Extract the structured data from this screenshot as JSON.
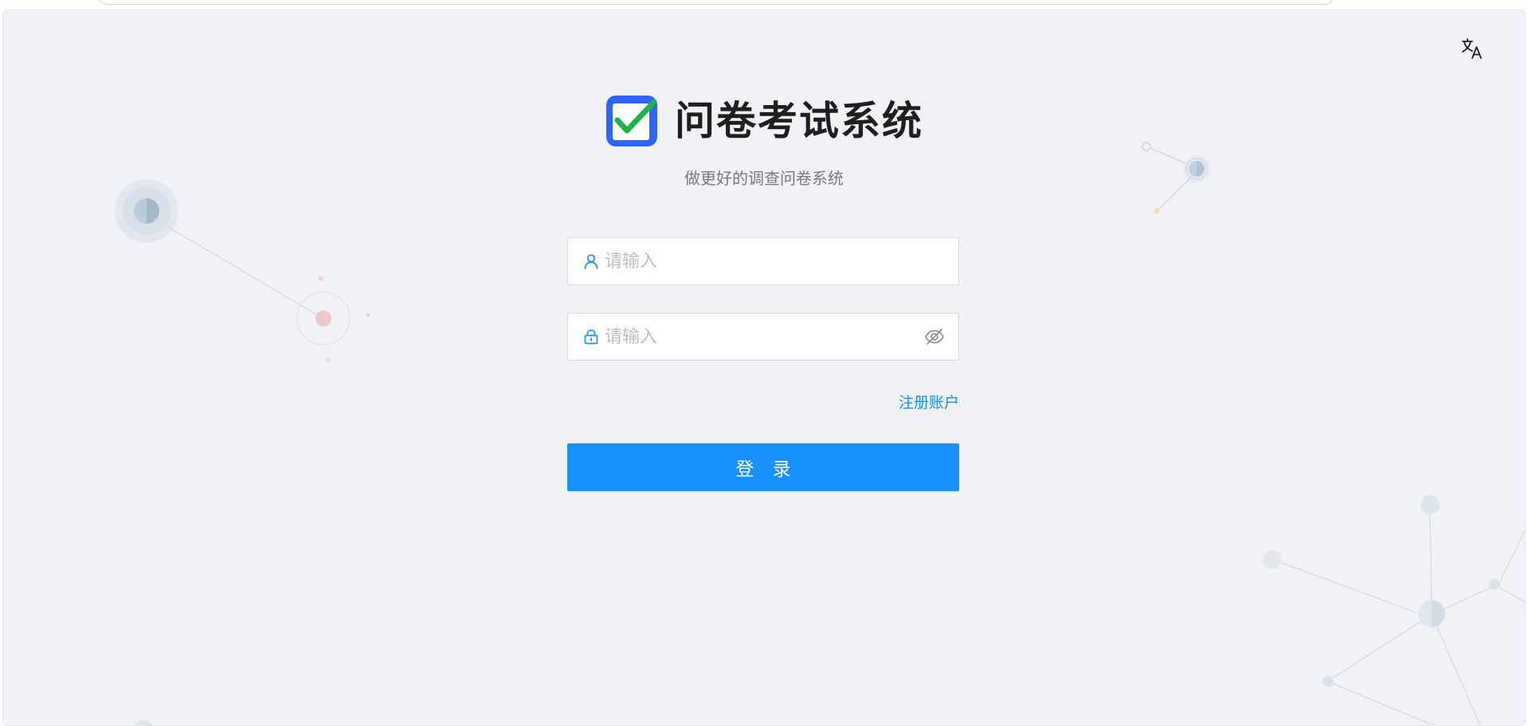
{
  "app": {
    "title": "问卷考试系统",
    "subtitle": "做更好的调查问卷系统"
  },
  "header": {
    "language_icon": "translate-icon"
  },
  "login_form": {
    "username": {
      "placeholder": "请输入",
      "value": "",
      "icon": "user-icon"
    },
    "password": {
      "placeholder": "请输入",
      "value": "",
      "icon": "lock-icon",
      "toggle_icon": "eye-invisible-icon"
    },
    "register_label": "注册账户",
    "submit_label": "登 录"
  },
  "colors": {
    "primary": "#1890ff",
    "background": "#f0f2f5",
    "logo_blue": "#2f64f5",
    "logo_check": "#22b14c"
  }
}
